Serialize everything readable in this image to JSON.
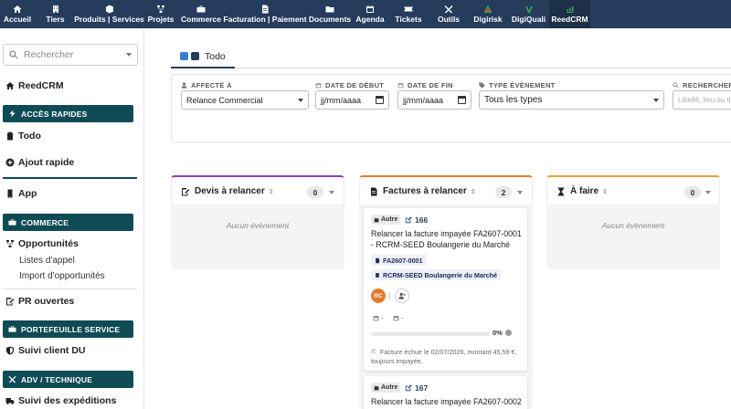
{
  "nav": [
    {
      "label": "Accueil",
      "icon": "home-icon"
    },
    {
      "label": "Tiers",
      "icon": "building-icon"
    },
    {
      "label": "Produits | Services",
      "icon": "cube-icon"
    },
    {
      "label": "Projets",
      "icon": "sitemap-icon"
    },
    {
      "label": "Commerce",
      "icon": "briefcase-icon"
    },
    {
      "label": "Facturation | Paiement",
      "icon": "invoice-icon"
    },
    {
      "label": "Documents",
      "icon": "folder-icon"
    },
    {
      "label": "Agenda",
      "icon": "calendar-icon"
    },
    {
      "label": "Tickets",
      "icon": "ticket-icon"
    },
    {
      "label": "Outils",
      "icon": "tools-icon"
    },
    {
      "label": "Digirisk",
      "icon": "digirisk-logo"
    },
    {
      "label": "DigiQuali",
      "icon": "digiquali-logo"
    },
    {
      "label": "ReedCRM",
      "icon": "reedcrm-logo"
    }
  ],
  "sidebar": {
    "search_placeholder": "Rechercher",
    "module": "ReedCRM",
    "quick_access": "ACCÈS RAPIDES",
    "todo": "Todo",
    "quick_add": "Ajout rapide",
    "app": "App",
    "commerce": "COMMERCE",
    "opportunities": "Opportunités",
    "call_lists": "Listes d'appel",
    "import_opps": "Import d'opportunités",
    "pr_open": "PR ouvertes",
    "portfolio": "PORTEFEUILLE SERVICE",
    "client_follow": "Suivi client DU",
    "adv": "ADV / TECHNIQUE",
    "shipping": "Suivi des expéditions"
  },
  "tab": {
    "label": "Todo"
  },
  "filters": {
    "assigned_label": "AFFECTÉ À",
    "assigned_value": "Relance Commercial",
    "start_label": "DATE DE DÉBUT",
    "start_value": "jj/mm/aaaa",
    "end_label": "DATE DE FIN",
    "end_value": "jj/mm/aaaa",
    "type_label": "TYPE ÉVÈNEMENT",
    "type_value": "Tous les types",
    "search_label": "RECHERCHER",
    "search_placeholder": "Libellé, lieu ou ti"
  },
  "columns": [
    {
      "title": "Devis à relancer",
      "count": "0",
      "empty": "Aucun évènement",
      "color": "#8e44ad"
    },
    {
      "title": "Factures à relancer",
      "count": "2",
      "color": "#e67e22"
    },
    {
      "title": "À faire",
      "count": "0",
      "empty": "Aucun évènement",
      "color": "#e8a23a"
    }
  ],
  "cards": [
    {
      "type": "Autre",
      "id": "166",
      "text": "Relancer la facture impayée FA2607-0001 - RCRM-SEED Boulangerie du Marché",
      "invoice": "FA2607-0001",
      "company": "RCRM-SEED Boulangerie du Marché",
      "avatar": "RC",
      "meta1": "-",
      "meta2": "-",
      "progress": 0,
      "progress_label": "0%",
      "note": "Facture échue le 02/07/2026, montant 45,59 €, toujours impayée."
    },
    {
      "type": "Autre",
      "id": "167",
      "text": "Relancer la facture impayée FA2607-0002 -"
    }
  ]
}
